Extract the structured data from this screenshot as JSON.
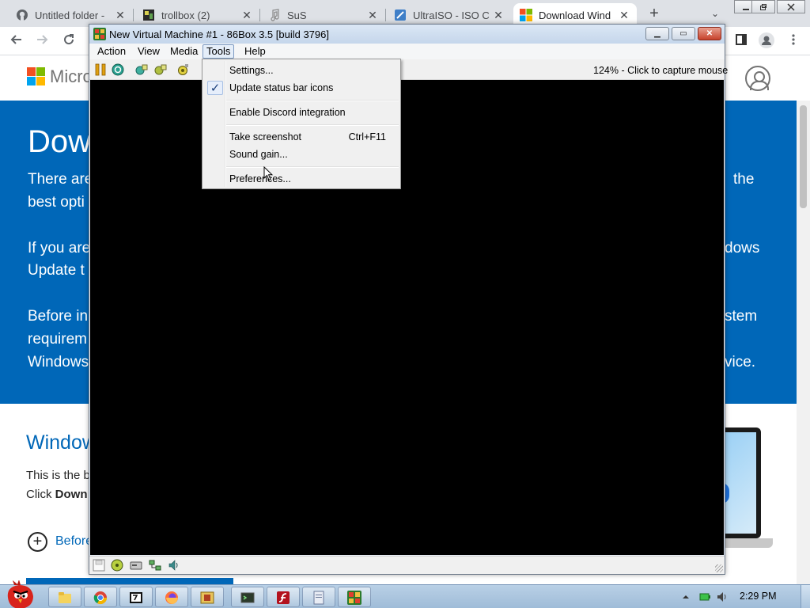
{
  "browser": {
    "tabs": [
      {
        "title": "Untitled folder - ",
        "icon": "github-icon"
      },
      {
        "title": "trollbox (2)",
        "icon": "trollbox-icon"
      },
      {
        "title": "SuS",
        "icon": "music-note-icon"
      },
      {
        "title": "UltraISO - ISO C",
        "icon": "ultraiso-icon"
      },
      {
        "title": "Download Wind",
        "icon": "microsoft-logo-icon",
        "active": true
      }
    ],
    "new_tab_label": "+",
    "tab_search_glyph": "⌄",
    "close_glyph": "✕"
  },
  "mspage": {
    "logo_text": "Micro",
    "title": "Dow",
    "banner_lines": [
      "There are",
      "best opti",
      "If you are",
      "Update t",
      "Before in",
      "requirem",
      "Windows"
    ],
    "banner_right": [
      "the",
      "dows",
      "stem",
      "vice."
    ],
    "section_title": "Window",
    "section_line1": "This is the b",
    "section_line2_prefix": "Click ",
    "section_line2_bold": "Down",
    "before_link": "Before",
    "plus_glyph": "+",
    "brand_blue": "#0067b8"
  },
  "vm": {
    "title": "New Virtual Machine #1 - 86Box 3.5 [build 3796]",
    "menu": [
      "Action",
      "View",
      "Media",
      "Tools",
      "Help"
    ],
    "open_menu": "Tools",
    "status_text": "124% - Click to capture mouse",
    "controls": {
      "minimize": "▁",
      "maximize": "▭",
      "close": "✕"
    }
  },
  "tools_menu": {
    "items": [
      {
        "label": "Settings...",
        "shortcut": "",
        "checked": false
      },
      {
        "label": "Update status bar icons",
        "shortcut": "",
        "checked": true
      },
      {
        "label": "Enable Discord integration",
        "shortcut": "",
        "checked": false
      },
      {
        "label": "Take screenshot",
        "shortcut": "Ctrl+F11",
        "checked": false
      },
      {
        "label": "Sound gain...",
        "shortcut": "",
        "checked": false
      },
      {
        "label": "Preferences...",
        "shortcut": "",
        "checked": false
      }
    ],
    "check_glyph": "✓"
  },
  "taskbar": {
    "clock": "2:29 PM",
    "apps": [
      "explorer-icon",
      "chrome-icon",
      "7zip-icon",
      "firefox-icon",
      "archive-icon",
      "terminal-icon",
      "flash-icon",
      "notepad-icon",
      "86box-icon"
    ]
  }
}
